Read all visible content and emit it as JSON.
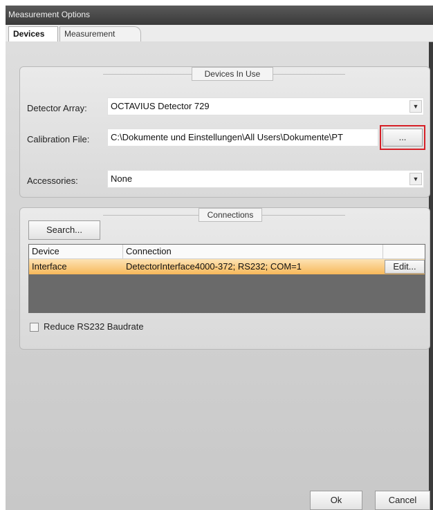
{
  "window": {
    "title": "Measurement Options"
  },
  "tabs": [
    {
      "label": "Devices"
    },
    {
      "label": "Measurement"
    }
  ],
  "devices_in_use": {
    "group_label": "Devices In Use",
    "detector_array": {
      "label": "Detector Array:",
      "value": "OCTAVIUS Detector 729"
    },
    "calibration_file": {
      "label": "Calibration File:",
      "value": "C:\\Dokumente und Einstellungen\\All Users\\Dokumente\\PT",
      "browse_label": "..."
    },
    "accessories": {
      "label": "Accessories:",
      "value": "None"
    }
  },
  "connections": {
    "group_label": "Connections",
    "search_label": "Search...",
    "columns": [
      "Device",
      "Connection"
    ],
    "rows": [
      {
        "device": "Interface",
        "connection": "DetectorInterface4000-372; RS232; COM=1",
        "edit_label": "Edit..."
      }
    ],
    "reduce_baudrate": {
      "label": "Reduce RS232 Baudrate",
      "checked": false
    }
  },
  "footer": {
    "ok_label": "Ok",
    "cancel_label": "Cancel"
  }
}
